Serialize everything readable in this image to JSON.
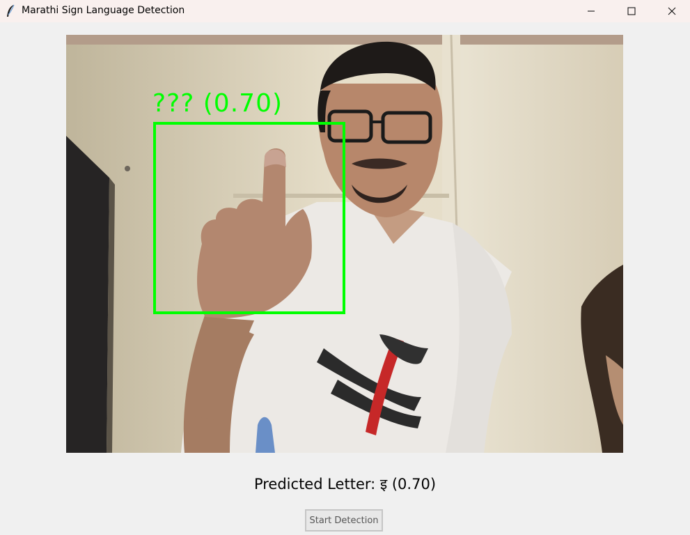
{
  "window": {
    "title": "Marathi Sign Language Detection",
    "icons": {
      "app": "feather-icon",
      "minimize": "minimize-icon",
      "maximize": "maximize-icon",
      "close": "close-icon"
    }
  },
  "video": {
    "detection_label": "??? (0.70)",
    "detection_color": "#00ff00"
  },
  "prediction": {
    "text": "Predicted Letter: इ (0.70)"
  },
  "controls": {
    "start_label": "Start Detection"
  }
}
